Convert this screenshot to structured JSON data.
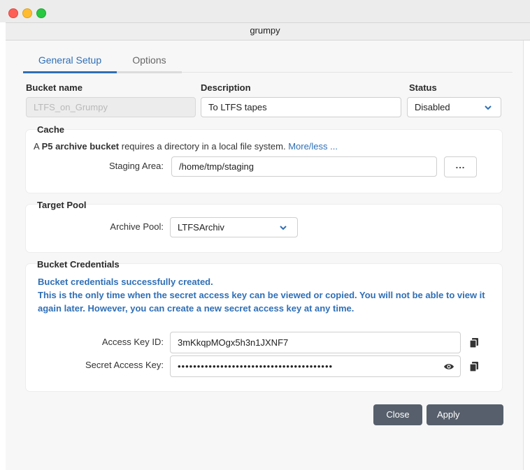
{
  "window": {
    "title": "grumpy"
  },
  "tabs": [
    {
      "label": "General Setup",
      "active": true
    },
    {
      "label": "Options",
      "active": false
    }
  ],
  "general": {
    "bucket_name_label": "Bucket name",
    "bucket_name_value": "LTFS_on_Grumpy",
    "description_label": "Description",
    "description_value": "To LTFS tapes",
    "status_label": "Status",
    "status_value": "Disabled"
  },
  "cache": {
    "title": "Cache",
    "text_prefix": "A ",
    "text_bold": "P5 archive bucket",
    "text_rest": " requires a directory in a local file system. ",
    "more_link": "More/less ...",
    "staging_label": "Staging Area:",
    "staging_value": "/home/tmp/staging",
    "browse_label": "..."
  },
  "target_pool": {
    "title": "Target Pool",
    "archive_label": "Archive Pool:",
    "archive_value": "LTFSArchiv"
  },
  "credentials": {
    "title": "Bucket Credentials",
    "message_line1": "Bucket credentials successfully created.",
    "message_line2": "This is the only time when the secret access key can be viewed or copied. You will not be able to view it again later. However, you can create a new secret access key at any time.",
    "access_key_label": "Access Key ID:",
    "access_key_value": "3mKkqpMOgx5h3n1JXNF7",
    "secret_key_label": "Secret Access Key:",
    "secret_key_value": "••••••••••••••••••••••••••••••••••••••••"
  },
  "buttons": {
    "close": "Close",
    "apply": "Apply"
  },
  "colors": {
    "accent": "#2f6fb6",
    "button": "#565f6b"
  }
}
